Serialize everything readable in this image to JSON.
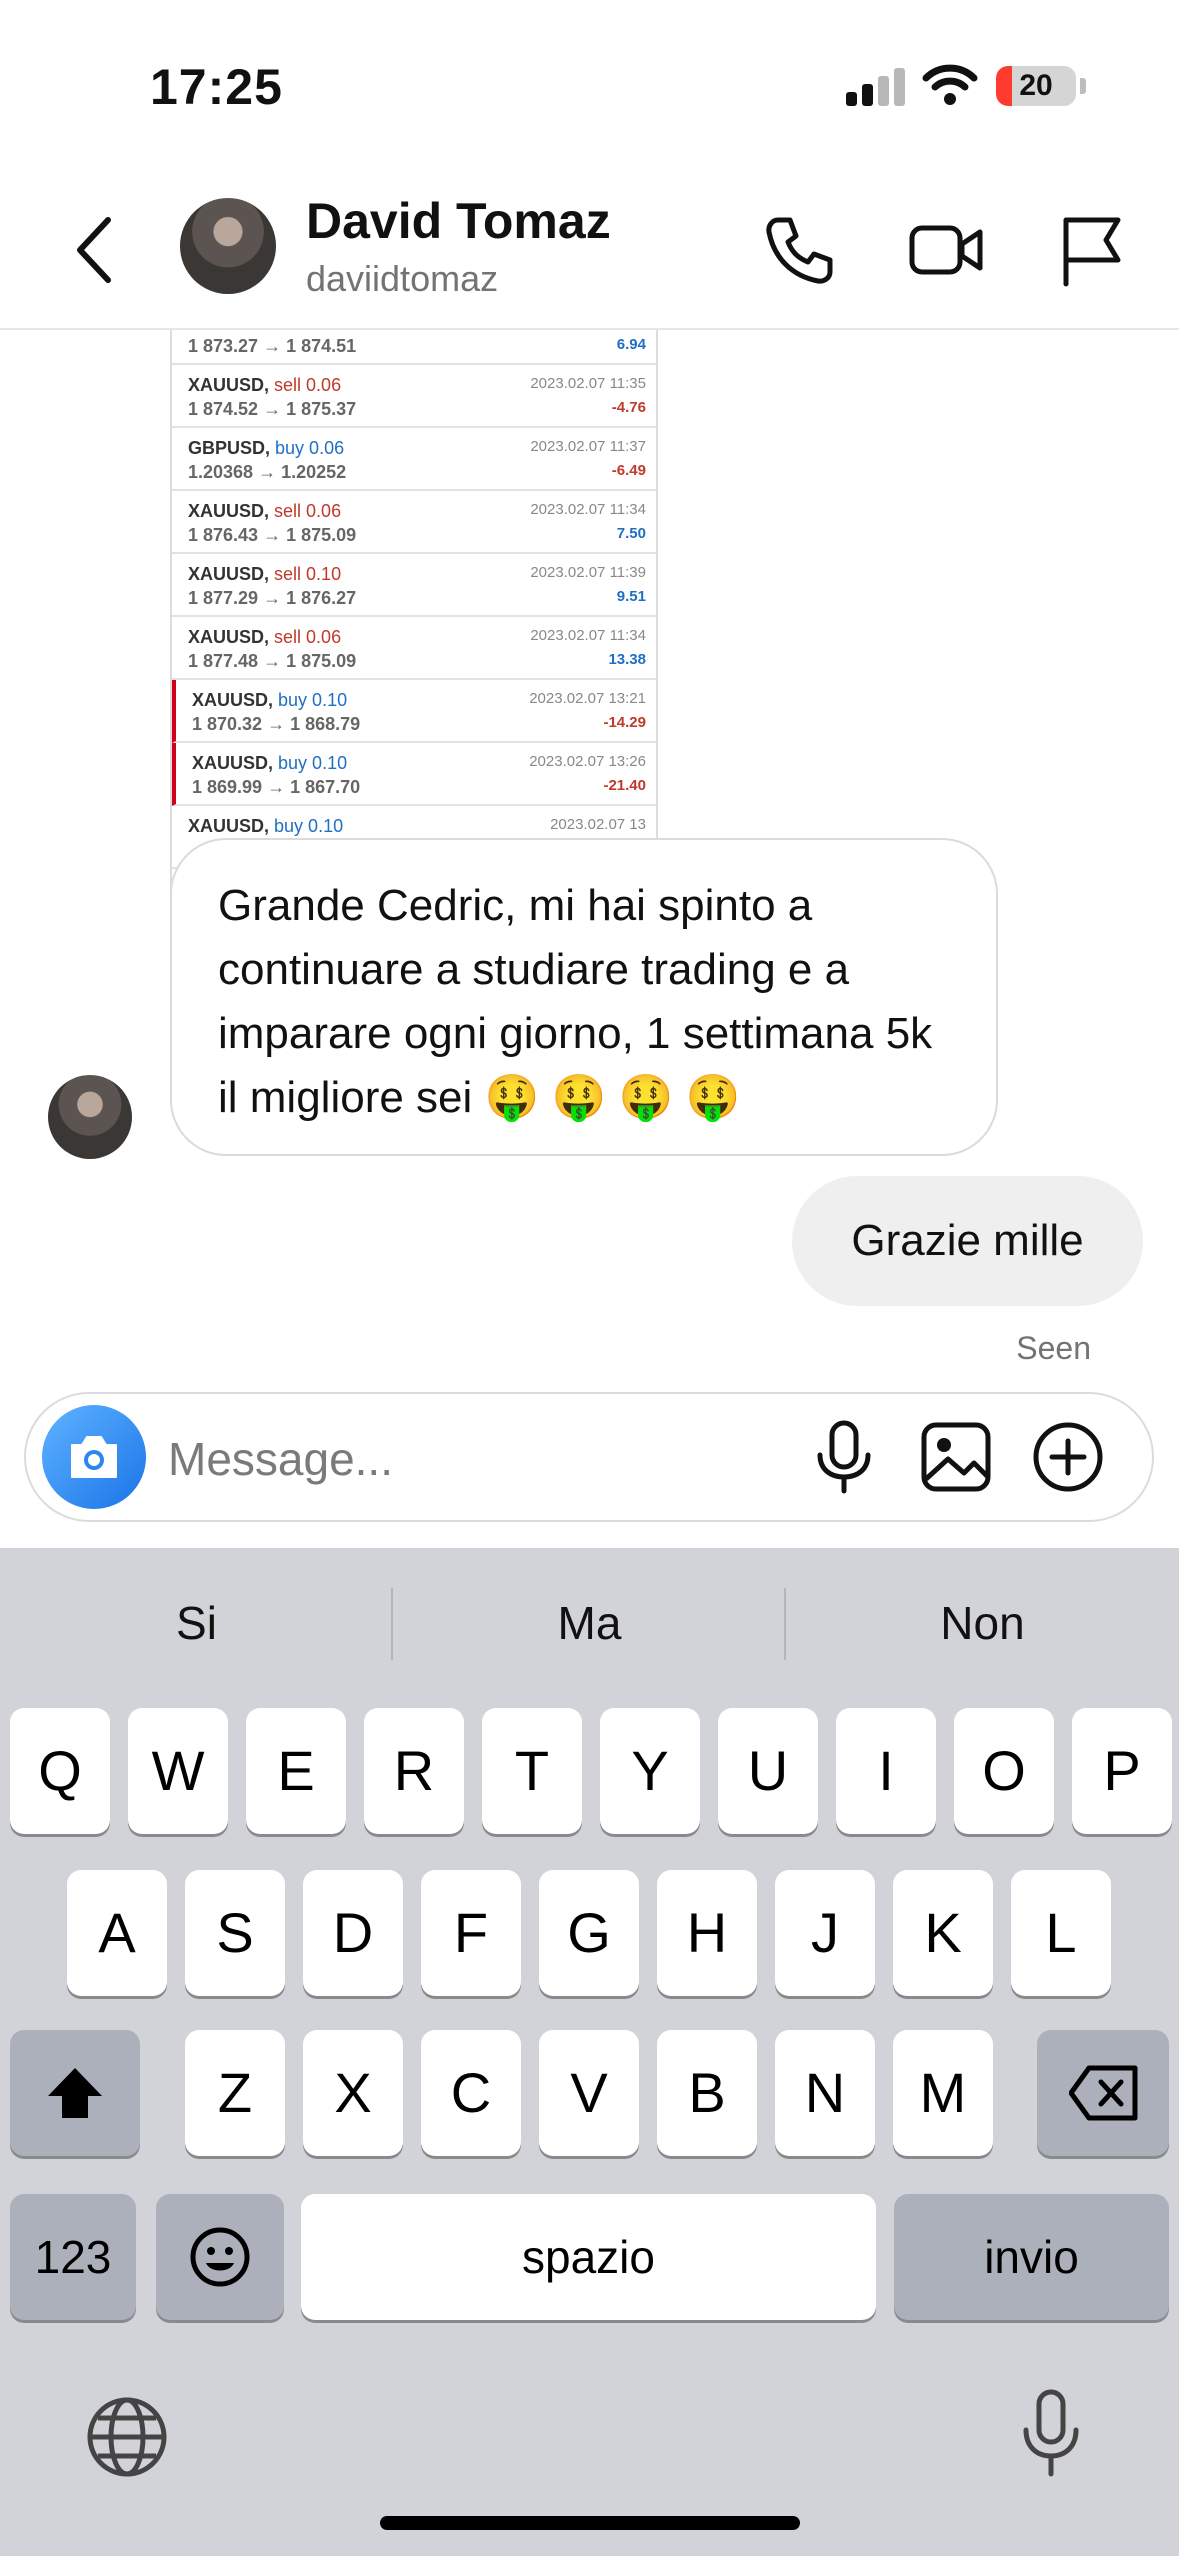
{
  "status_bar": {
    "time": "17:25",
    "battery": "20",
    "battery_level": 0.2
  },
  "header": {
    "name": "David Tomaz",
    "username": "daviidtomaz"
  },
  "trades": [
    {
      "symbol": "",
      "side": "",
      "side_class": "",
      "price": "1 873.27 → 1 874.51",
      "date": "",
      "pl": "6.94",
      "pl_class": "pos",
      "flag": false
    },
    {
      "symbol": "XAUUSD,",
      "side": "sell 0.06",
      "side_class": "sell",
      "price": "1 874.52 → 1 875.37",
      "date": "2023.02.07 11:35",
      "pl": "-4.76",
      "pl_class": "neg",
      "flag": false
    },
    {
      "symbol": "GBPUSD,",
      "side": "buy 0.06",
      "side_class": "buy",
      "price": "1.20368 → 1.20252",
      "date": "2023.02.07 11:37",
      "pl": "-6.49",
      "pl_class": "neg",
      "flag": false
    },
    {
      "symbol": "XAUUSD,",
      "side": "sell 0.06",
      "side_class": "sell",
      "price": "1 876.43 → 1 875.09",
      "date": "2023.02.07 11:34",
      "pl": "7.50",
      "pl_class": "pos",
      "flag": false
    },
    {
      "symbol": "XAUUSD,",
      "side": "sell 0.10",
      "side_class": "sell",
      "price": "1 877.29 → 1 876.27",
      "date": "2023.02.07 11:39",
      "pl": "9.51",
      "pl_class": "pos",
      "flag": false
    },
    {
      "symbol": "XAUUSD,",
      "side": "sell 0.06",
      "side_class": "sell",
      "price": "1 877.48 → 1 875.09",
      "date": "2023.02.07 11:34",
      "pl": "13.38",
      "pl_class": "pos",
      "flag": false
    },
    {
      "symbol": "XAUUSD,",
      "side": "buy 0.10",
      "side_class": "buy",
      "price": "1 870.32 → 1 868.79",
      "date": "2023.02.07 13:21",
      "pl": "-14.29",
      "pl_class": "neg",
      "flag": true
    },
    {
      "symbol": "XAUUSD,",
      "side": "buy 0.10",
      "side_class": "buy",
      "price": "1 869.99 → 1 867.70",
      "date": "2023.02.07 13:26",
      "pl": "-21.40",
      "pl_class": "neg",
      "flag": true
    },
    {
      "symbol": "XAUUSD,",
      "side": "buy 0.10",
      "side_class": "buy",
      "price": "",
      "date": "2023.02.07 13",
      "pl": "",
      "pl_class": "neg",
      "flag": false
    }
  ],
  "messages": {
    "incoming": "Grande  Cedric, mi hai spinto a continuare a studiare  trading e a imparare ogni giorno, 1 settimana 5k il migliore sei 🤑 🤑 🤑 🤑",
    "outgoing": "Grazie mille",
    "seen": "Seen"
  },
  "composer": {
    "placeholder": "Message..."
  },
  "keyboard": {
    "suggestions": [
      "Si",
      "Ma",
      "Non"
    ],
    "row1": [
      "Q",
      "W",
      "E",
      "R",
      "T",
      "Y",
      "U",
      "I",
      "O",
      "P"
    ],
    "row2": [
      "A",
      "S",
      "D",
      "F",
      "G",
      "H",
      "J",
      "K",
      "L"
    ],
    "row3": [
      "Z",
      "X",
      "C",
      "V",
      "B",
      "N",
      "M"
    ],
    "numbers_key": "123",
    "space_key": "spazio",
    "return_key": "invio"
  }
}
